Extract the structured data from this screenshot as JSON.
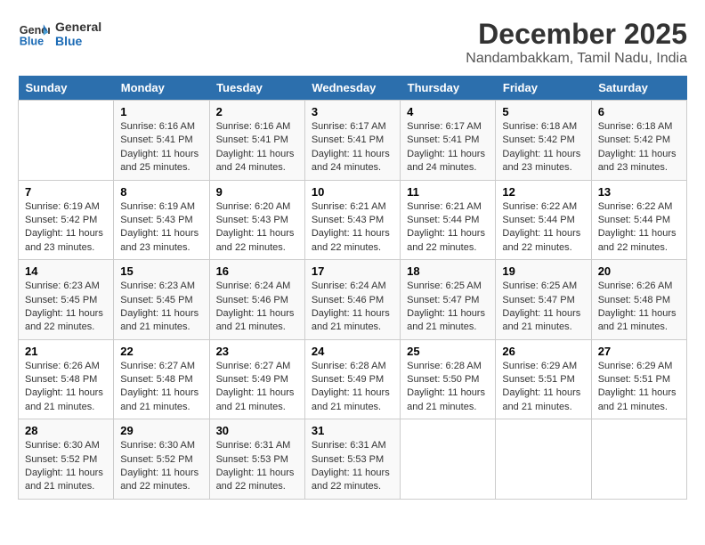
{
  "logo": {
    "line1": "General",
    "line2": "Blue"
  },
  "title": "December 2025",
  "subtitle": "Nandambakkam, Tamil Nadu, India",
  "days_of_week": [
    "Sunday",
    "Monday",
    "Tuesday",
    "Wednesday",
    "Thursday",
    "Friday",
    "Saturday"
  ],
  "weeks": [
    [
      {
        "day": "",
        "sunrise": "",
        "sunset": "",
        "daylight": ""
      },
      {
        "day": "1",
        "sunrise": "Sunrise: 6:16 AM",
        "sunset": "Sunset: 5:41 PM",
        "daylight": "Daylight: 11 hours and 25 minutes."
      },
      {
        "day": "2",
        "sunrise": "Sunrise: 6:16 AM",
        "sunset": "Sunset: 5:41 PM",
        "daylight": "Daylight: 11 hours and 24 minutes."
      },
      {
        "day": "3",
        "sunrise": "Sunrise: 6:17 AM",
        "sunset": "Sunset: 5:41 PM",
        "daylight": "Daylight: 11 hours and 24 minutes."
      },
      {
        "day": "4",
        "sunrise": "Sunrise: 6:17 AM",
        "sunset": "Sunset: 5:41 PM",
        "daylight": "Daylight: 11 hours and 24 minutes."
      },
      {
        "day": "5",
        "sunrise": "Sunrise: 6:18 AM",
        "sunset": "Sunset: 5:42 PM",
        "daylight": "Daylight: 11 hours and 23 minutes."
      },
      {
        "day": "6",
        "sunrise": "Sunrise: 6:18 AM",
        "sunset": "Sunset: 5:42 PM",
        "daylight": "Daylight: 11 hours and 23 minutes."
      }
    ],
    [
      {
        "day": "7",
        "sunrise": "Sunrise: 6:19 AM",
        "sunset": "Sunset: 5:42 PM",
        "daylight": "Daylight: 11 hours and 23 minutes."
      },
      {
        "day": "8",
        "sunrise": "Sunrise: 6:19 AM",
        "sunset": "Sunset: 5:43 PM",
        "daylight": "Daylight: 11 hours and 23 minutes."
      },
      {
        "day": "9",
        "sunrise": "Sunrise: 6:20 AM",
        "sunset": "Sunset: 5:43 PM",
        "daylight": "Daylight: 11 hours and 22 minutes."
      },
      {
        "day": "10",
        "sunrise": "Sunrise: 6:21 AM",
        "sunset": "Sunset: 5:43 PM",
        "daylight": "Daylight: 11 hours and 22 minutes."
      },
      {
        "day": "11",
        "sunrise": "Sunrise: 6:21 AM",
        "sunset": "Sunset: 5:44 PM",
        "daylight": "Daylight: 11 hours and 22 minutes."
      },
      {
        "day": "12",
        "sunrise": "Sunrise: 6:22 AM",
        "sunset": "Sunset: 5:44 PM",
        "daylight": "Daylight: 11 hours and 22 minutes."
      },
      {
        "day": "13",
        "sunrise": "Sunrise: 6:22 AM",
        "sunset": "Sunset: 5:44 PM",
        "daylight": "Daylight: 11 hours and 22 minutes."
      }
    ],
    [
      {
        "day": "14",
        "sunrise": "Sunrise: 6:23 AM",
        "sunset": "Sunset: 5:45 PM",
        "daylight": "Daylight: 11 hours and 22 minutes."
      },
      {
        "day": "15",
        "sunrise": "Sunrise: 6:23 AM",
        "sunset": "Sunset: 5:45 PM",
        "daylight": "Daylight: 11 hours and 21 minutes."
      },
      {
        "day": "16",
        "sunrise": "Sunrise: 6:24 AM",
        "sunset": "Sunset: 5:46 PM",
        "daylight": "Daylight: 11 hours and 21 minutes."
      },
      {
        "day": "17",
        "sunrise": "Sunrise: 6:24 AM",
        "sunset": "Sunset: 5:46 PM",
        "daylight": "Daylight: 11 hours and 21 minutes."
      },
      {
        "day": "18",
        "sunrise": "Sunrise: 6:25 AM",
        "sunset": "Sunset: 5:47 PM",
        "daylight": "Daylight: 11 hours and 21 minutes."
      },
      {
        "day": "19",
        "sunrise": "Sunrise: 6:25 AM",
        "sunset": "Sunset: 5:47 PM",
        "daylight": "Daylight: 11 hours and 21 minutes."
      },
      {
        "day": "20",
        "sunrise": "Sunrise: 6:26 AM",
        "sunset": "Sunset: 5:48 PM",
        "daylight": "Daylight: 11 hours and 21 minutes."
      }
    ],
    [
      {
        "day": "21",
        "sunrise": "Sunrise: 6:26 AM",
        "sunset": "Sunset: 5:48 PM",
        "daylight": "Daylight: 11 hours and 21 minutes."
      },
      {
        "day": "22",
        "sunrise": "Sunrise: 6:27 AM",
        "sunset": "Sunset: 5:48 PM",
        "daylight": "Daylight: 11 hours and 21 minutes."
      },
      {
        "day": "23",
        "sunrise": "Sunrise: 6:27 AM",
        "sunset": "Sunset: 5:49 PM",
        "daylight": "Daylight: 11 hours and 21 minutes."
      },
      {
        "day": "24",
        "sunrise": "Sunrise: 6:28 AM",
        "sunset": "Sunset: 5:49 PM",
        "daylight": "Daylight: 11 hours and 21 minutes."
      },
      {
        "day": "25",
        "sunrise": "Sunrise: 6:28 AM",
        "sunset": "Sunset: 5:50 PM",
        "daylight": "Daylight: 11 hours and 21 minutes."
      },
      {
        "day": "26",
        "sunrise": "Sunrise: 6:29 AM",
        "sunset": "Sunset: 5:51 PM",
        "daylight": "Daylight: 11 hours and 21 minutes."
      },
      {
        "day": "27",
        "sunrise": "Sunrise: 6:29 AM",
        "sunset": "Sunset: 5:51 PM",
        "daylight": "Daylight: 11 hours and 21 minutes."
      }
    ],
    [
      {
        "day": "28",
        "sunrise": "Sunrise: 6:30 AM",
        "sunset": "Sunset: 5:52 PM",
        "daylight": "Daylight: 11 hours and 21 minutes."
      },
      {
        "day": "29",
        "sunrise": "Sunrise: 6:30 AM",
        "sunset": "Sunset: 5:52 PM",
        "daylight": "Daylight: 11 hours and 22 minutes."
      },
      {
        "day": "30",
        "sunrise": "Sunrise: 6:31 AM",
        "sunset": "Sunset: 5:53 PM",
        "daylight": "Daylight: 11 hours and 22 minutes."
      },
      {
        "day": "31",
        "sunrise": "Sunrise: 6:31 AM",
        "sunset": "Sunset: 5:53 PM",
        "daylight": "Daylight: 11 hours and 22 minutes."
      },
      {
        "day": "",
        "sunrise": "",
        "sunset": "",
        "daylight": ""
      },
      {
        "day": "",
        "sunrise": "",
        "sunset": "",
        "daylight": ""
      },
      {
        "day": "",
        "sunrise": "",
        "sunset": "",
        "daylight": ""
      }
    ]
  ]
}
